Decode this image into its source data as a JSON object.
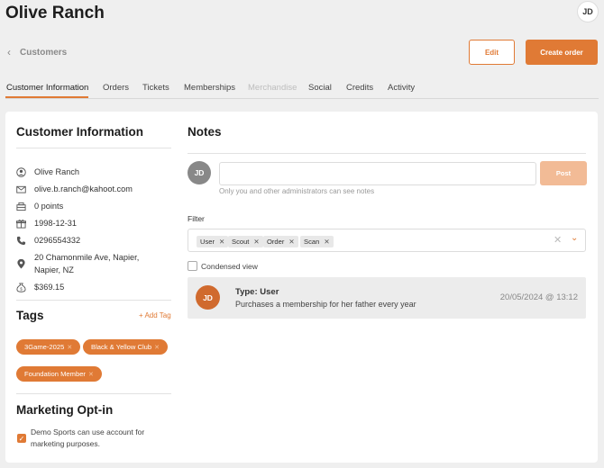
{
  "header": {
    "title": "Olive Ranch",
    "user_initials": "JD"
  },
  "breadcrumb": {
    "back_label": "Customers"
  },
  "actions": {
    "edit_label": "Edit",
    "create_order_label": "Create order"
  },
  "tabs": [
    {
      "label": "Customer Information",
      "state": "active"
    },
    {
      "label": "Orders",
      "state": "normal"
    },
    {
      "label": "Tickets",
      "state": "normal"
    },
    {
      "label": "Memberships",
      "state": "normal"
    },
    {
      "label": "Merchandise",
      "state": "disabled"
    },
    {
      "label": "Social",
      "state": "normal"
    },
    {
      "label": "Credits",
      "state": "normal"
    },
    {
      "label": "Activity",
      "state": "normal"
    }
  ],
  "customer_info": {
    "title": "Customer Information",
    "name": "Olive Ranch",
    "email": "olive.b.ranch@kahoot.com",
    "points": "0 points",
    "dob": "1998-12-31",
    "phone": "0296554332",
    "address_line1": "20 Chamonmile Ave, Napier,",
    "address_line2": "Napier, NZ",
    "balance": "$369.15"
  },
  "tags": {
    "title": "Tags",
    "add_label": "+ Add Tag",
    "items": [
      "3Game-2025",
      "Black & Yellow Club",
      "Foundation Member"
    ]
  },
  "marketing": {
    "title": "Marketing Opt-in",
    "checked": true,
    "text": "Demo Sports can use account for marketing purposes."
  },
  "notes": {
    "title": "Notes",
    "author_initials": "JD",
    "input_value": "",
    "post_label": "Post",
    "hint": "Only you and other administrators can see notes",
    "filter_label": "Filter",
    "filter_chips": [
      "User",
      "Scout",
      "Order",
      "Scan"
    ],
    "condensed_label": "Condensed view",
    "condensed_checked": false,
    "entries": [
      {
        "initials": "JD",
        "type": "Type: User",
        "text": "Purchases a membership for her father every year",
        "date": "20/05/2024 @ 13:12"
      }
    ]
  },
  "colors": {
    "accent": "#e07a35",
    "accent_light": "#f2bb96",
    "page_bg": "#efefef"
  }
}
